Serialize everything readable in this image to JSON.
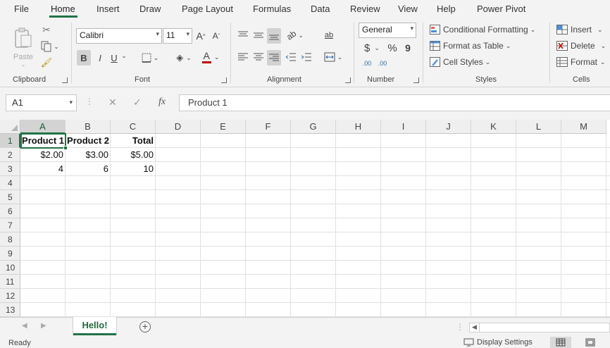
{
  "menu": {
    "tabs": [
      "File",
      "Home",
      "Insert",
      "Draw",
      "Page Layout",
      "Formulas",
      "Data",
      "Review",
      "View",
      "Help",
      "Power Pivot"
    ],
    "active": "Home"
  },
  "ribbon": {
    "clipboard": {
      "label": "Clipboard",
      "paste": "Paste"
    },
    "font": {
      "label": "Font",
      "name": "Calibri",
      "size": "11",
      "bold": "B",
      "italic": "I",
      "underline": "U"
    },
    "alignment": {
      "label": "Alignment"
    },
    "number": {
      "label": "Number",
      "format": "General",
      "currency": "$",
      "percent": "%",
      "comma": "9",
      "inc_decimal": ".00",
      "dec_decimal": ".00"
    },
    "styles": {
      "label": "Styles",
      "conditional": "Conditional Formatting",
      "format_table": "Format as Table",
      "cell_styles": "Cell Styles"
    },
    "cells": {
      "label": "Cells",
      "insert": "Insert",
      "delete": "Delete",
      "format": "Format"
    }
  },
  "formula_bar": {
    "name_box": "A1",
    "fx": "fx",
    "value": "Product 1"
  },
  "sheet": {
    "columns": [
      "A",
      "B",
      "C",
      "D",
      "E",
      "F",
      "G",
      "H",
      "I",
      "J",
      "K",
      "L",
      "M"
    ],
    "rows": [
      "1",
      "2",
      "3",
      "4",
      "5",
      "6",
      "7",
      "8",
      "9",
      "10",
      "11",
      "12",
      "13"
    ],
    "cells": {
      "A1": "Product 1",
      "B1": "Product 2",
      "C1": "Total",
      "A2": "$2.00",
      "B2": "$3.00",
      "C2": "$5.00",
      "A3": "4",
      "B3": "6",
      "C3": "10"
    },
    "selected_cell": "A1"
  },
  "sheet_tabs": {
    "active": "Hello!",
    "add": "+"
  },
  "status": {
    "mode": "Ready",
    "display_settings": "Display Settings"
  },
  "colors": {
    "accent": "#217346",
    "font_color_bar": "#c00000"
  }
}
